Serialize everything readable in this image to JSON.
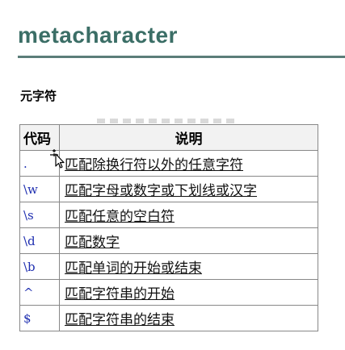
{
  "page": {
    "title": "metacharacter",
    "section_label": "元字符"
  },
  "table": {
    "headers": [
      "代码",
      "说明"
    ],
    "rows": [
      {
        "code": ".",
        "desc": "匹配除换行符以外的任意字符"
      },
      {
        "code": "\\w",
        "desc": "匹配字母或数字或下划线或汉字"
      },
      {
        "code": "\\s",
        "desc": "匹配任意的空白符"
      },
      {
        "code": "\\d",
        "desc": "匹配数字"
      },
      {
        "code": "\\b",
        "desc": "匹配单词的开始或结束"
      },
      {
        "code": "^",
        "desc": "匹配字符串的开始"
      },
      {
        "code": "$",
        "desc": "匹配字符串的结束"
      }
    ]
  },
  "colors": {
    "title": "#3b6e66",
    "rule": "#5b7d79",
    "code": "#1f2fb0"
  },
  "icons": {
    "cursor": "move-cursor-icon"
  }
}
